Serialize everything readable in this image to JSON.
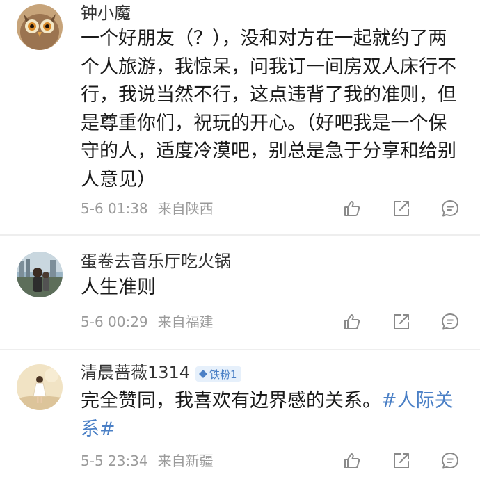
{
  "comments": [
    {
      "username": "钟小魔",
      "text": "一个好朋友（？），没和对方在一起就约了两个人旅游，我惊呆，问我订一间房双人床行不行，我说当然不行，这点违背了我的准则，但是尊重你们，祝玩的开心。（好吧我是一个保守的人，适度冷漠吧，别总是急于分享和给别人意见）",
      "date": "5-6 01:38",
      "location": "来自陕西",
      "avatar_icon": "owl-avatar"
    },
    {
      "username": "蛋卷去音乐厅吃火锅",
      "text": "人生准则",
      "date": "5-6 00:29",
      "location": "来自福建",
      "avatar_icon": "photo-avatar"
    },
    {
      "username": "清晨蔷薇1314",
      "badge": "铁粉1",
      "text": "完全赞同，我喜欢有边界感的关系。",
      "hashtag": "#人际关系#",
      "date": "5-5 23:34",
      "location": "来自新疆",
      "avatar_icon": "girl-avatar"
    }
  ],
  "actions": {
    "like_icon": "thumbs-up-icon",
    "share_icon": "share-icon",
    "reply_icon": "comment-icon"
  },
  "colors": {
    "hashtag": "#4b80c6",
    "meta": "#9a9a9a",
    "icon": "#8a8a8a",
    "badge_bg": "#e6f0fb"
  }
}
